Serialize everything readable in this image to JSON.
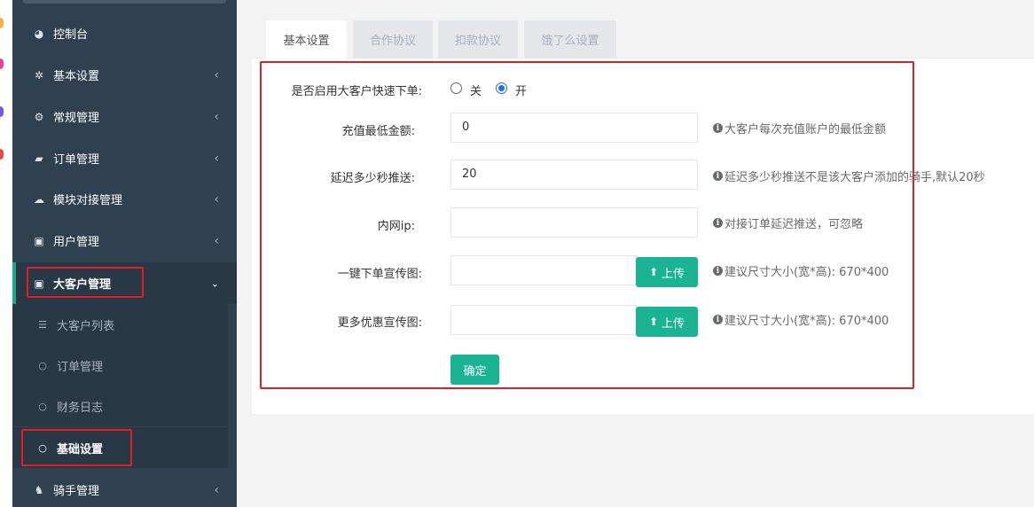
{
  "sidebar": {
    "items": [
      {
        "label": "控制台",
        "icon": "dashboard-icon"
      },
      {
        "label": "基本设置",
        "icon": "gear-icon"
      },
      {
        "label": "常规管理",
        "icon": "gears-icon"
      },
      {
        "label": "订单管理",
        "icon": "book-icon"
      },
      {
        "label": "模块对接管理",
        "icon": "cloud-icon"
      },
      {
        "label": "用户管理",
        "icon": "address-book-icon"
      },
      {
        "label": "大客户管理",
        "icon": "contact-card-icon"
      },
      {
        "label": "骑手管理",
        "icon": "rider-icon"
      }
    ],
    "sub_items": [
      {
        "label": "大客户列表",
        "icon": "list-icon"
      },
      {
        "label": "订单管理",
        "icon": "circle-icon"
      },
      {
        "label": "财务日志",
        "icon": "circle-icon"
      },
      {
        "label": "基础设置",
        "icon": "circle-icon"
      }
    ]
  },
  "tabs": [
    {
      "label": "基本设置"
    },
    {
      "label": "合作协议"
    },
    {
      "label": "扣款协议"
    },
    {
      "label": "饿了么设置"
    }
  ],
  "form": {
    "quick_order": {
      "label": "是否启用大客户快速下单:",
      "off_label": "关",
      "on_label": "开",
      "selected": "开"
    },
    "min_recharge": {
      "label": "充值最低金额:",
      "value": "0",
      "help": "大客户每次充值账户的最低金额"
    },
    "delay_push": {
      "label": "延迟多少秒推送:",
      "value": "20",
      "help": "延迟多少秒推送不是该大客户添加的骑手,默认20秒"
    },
    "intranet_ip": {
      "label": "内网ip:",
      "value": "",
      "help": "对接订单延迟推送，可忽略"
    },
    "one_click_banner": {
      "label": "一键下单宣传图:",
      "value": "",
      "upload_label": "上传",
      "help": "建议尺寸大小(宽*高): 670*400"
    },
    "promo_banner": {
      "label": "更多优惠宣传图:",
      "value": "",
      "upload_label": "上传",
      "help": "建议尺寸大小(宽*高): 670*400"
    },
    "confirm_label": "确定"
  },
  "colors": {
    "sidebar_bg": "#2f4050",
    "sidebar_active_bg": "#293846",
    "accent": "#1ab394",
    "highlight_box": "#e02020",
    "radio_selected": "#1a73e8"
  }
}
